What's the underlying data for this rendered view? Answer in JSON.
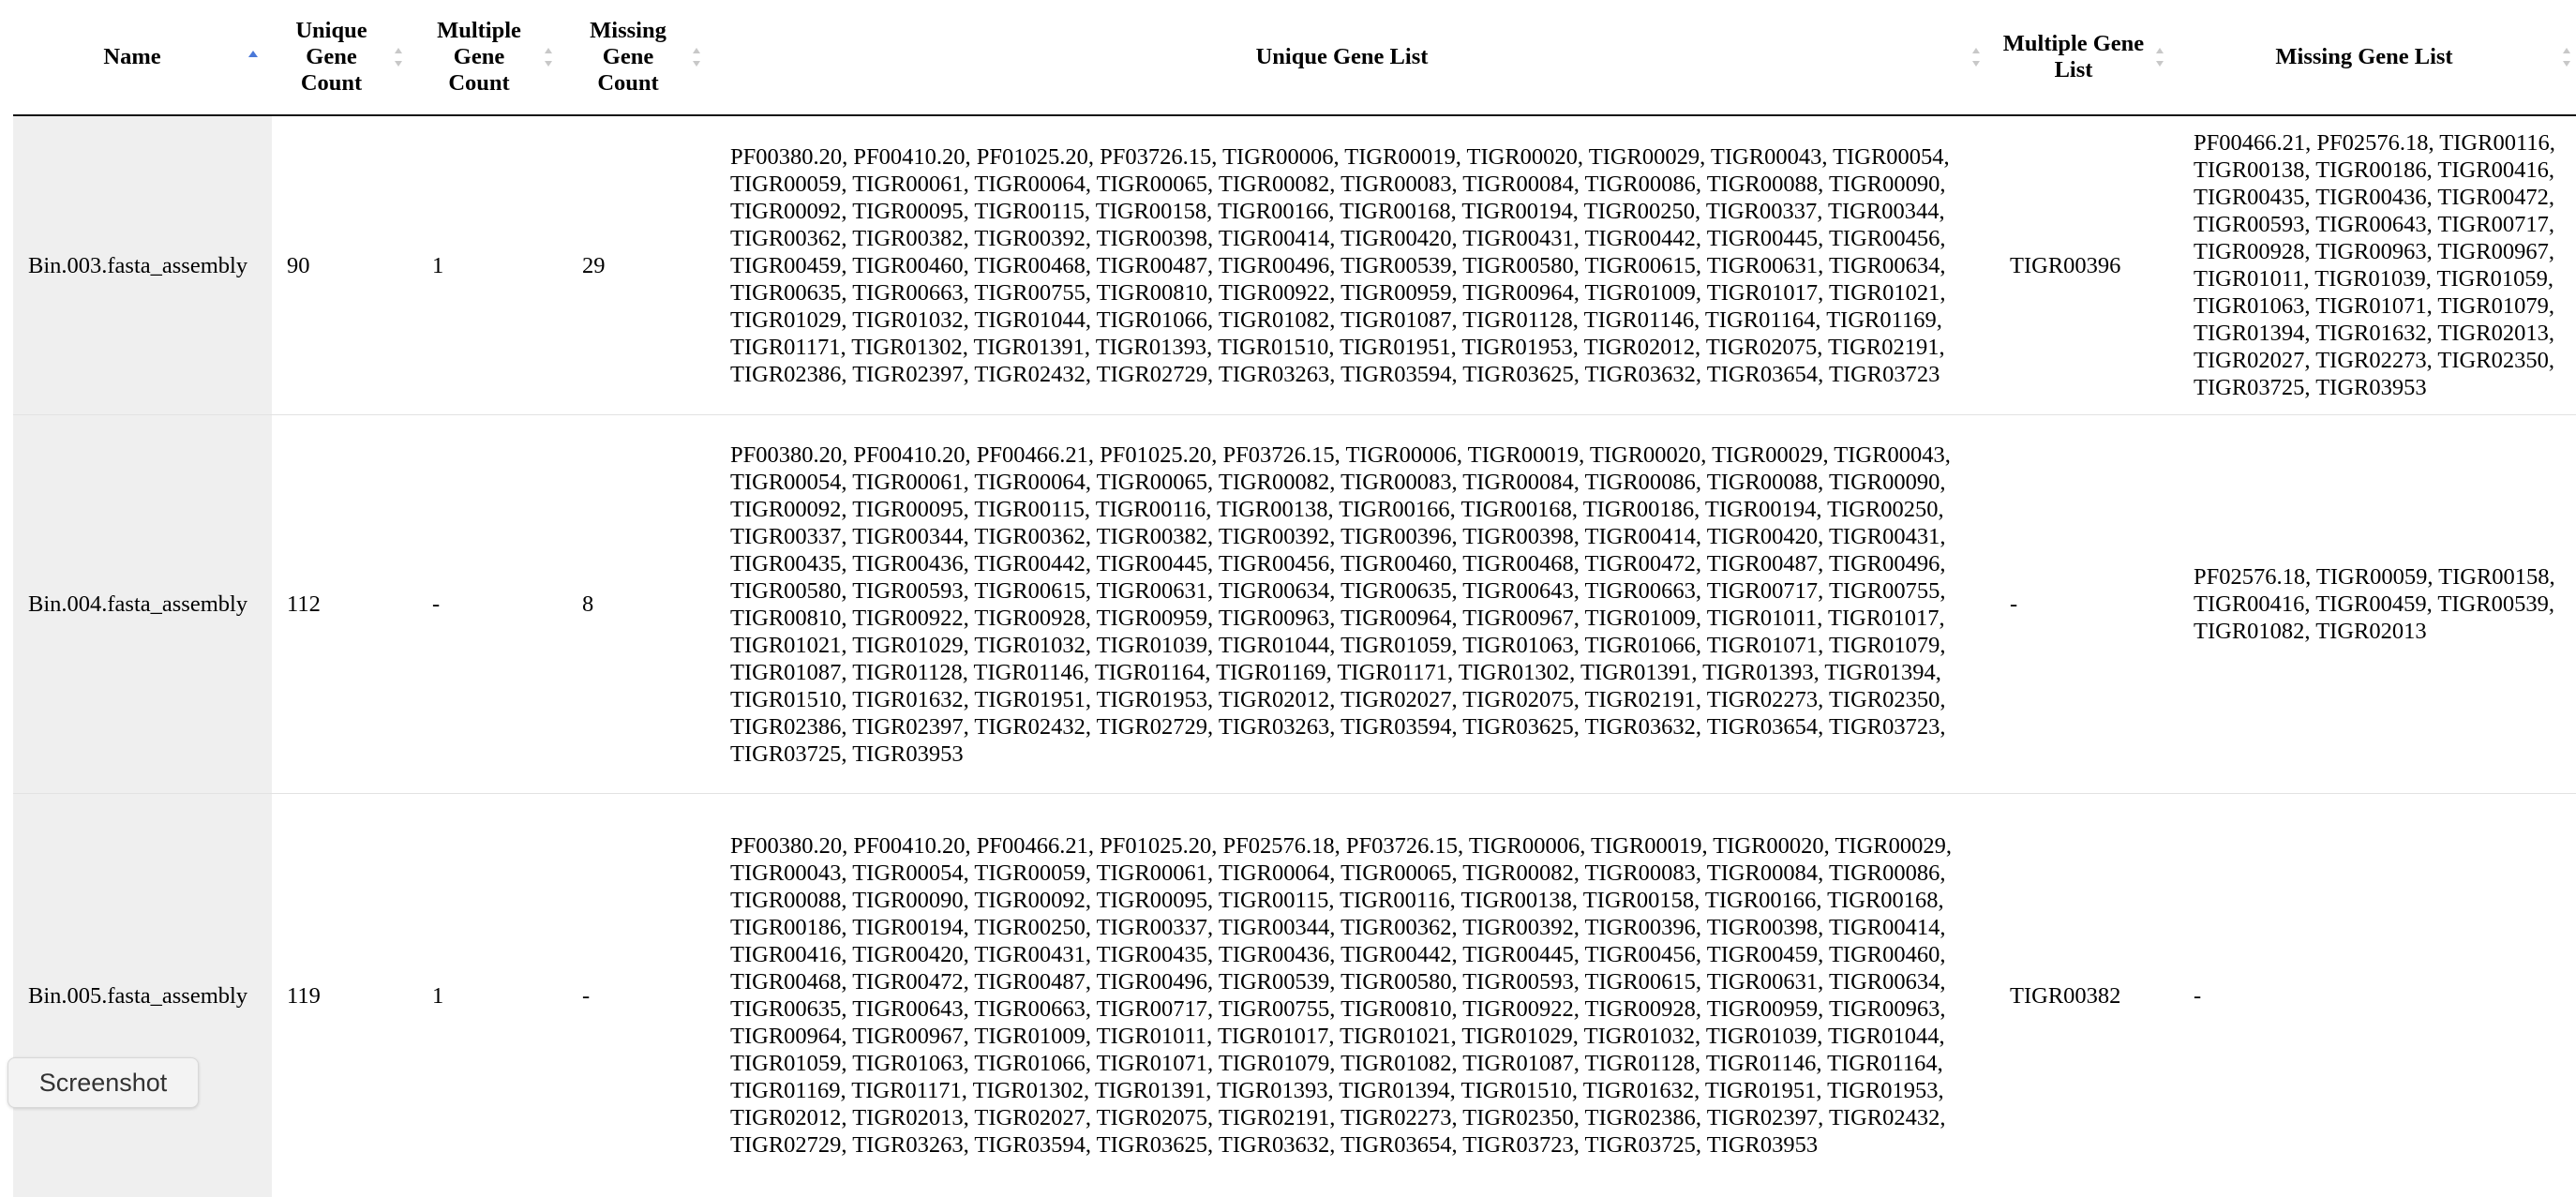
{
  "table": {
    "headers": [
      {
        "label": "Name",
        "sort": "asc"
      },
      {
        "label": "Unique Gene Count",
        "sort": "none"
      },
      {
        "label": "Multiple Gene Count",
        "sort": "none"
      },
      {
        "label": "Missing Gene Count",
        "sort": "none"
      },
      {
        "label": "Unique Gene List",
        "sort": "none"
      },
      {
        "label": "Multiple Gene List",
        "sort": "none"
      },
      {
        "label": "Missing Gene List",
        "sort": "none"
      }
    ],
    "rows": [
      {
        "name": "Bin.003.fasta_assembly",
        "unique_count": "90",
        "multiple_count": "1",
        "missing_count": "29",
        "unique_list": "PF00380.20, PF00410.20, PF01025.20, PF03726.15, TIGR00006, TIGR00019, TIGR00020, TIGR00029, TIGR00043, TIGR00054, TIGR00059, TIGR00061, TIGR00064, TIGR00065, TIGR00082, TIGR00083, TIGR00084, TIGR00086, TIGR00088, TIGR00090, TIGR00092, TIGR00095, TIGR00115, TIGR00158, TIGR00166, TIGR00168, TIGR00194, TIGR00250, TIGR00337, TIGR00344, TIGR00362, TIGR00382, TIGR00392, TIGR00398, TIGR00414, TIGR00420, TIGR00431, TIGR00442, TIGR00445, TIGR00456, TIGR00459, TIGR00460, TIGR00468, TIGR00487, TIGR00496, TIGR00539, TIGR00580, TIGR00615, TIGR00631, TIGR00634, TIGR00635, TIGR00663, TIGR00755, TIGR00810, TIGR00922, TIGR00959, TIGR00964, TIGR01009, TIGR01017, TIGR01021, TIGR01029, TIGR01032, TIGR01044, TIGR01066, TIGR01082, TIGR01087, TIGR01128, TIGR01146, TIGR01164, TIGR01169, TIGR01171, TIGR01302, TIGR01391, TIGR01393, TIGR01510, TIGR01951, TIGR01953, TIGR02012, TIGR02075, TIGR02191, TIGR02386, TIGR02397, TIGR02432, TIGR02729, TIGR03263, TIGR03594, TIGR03625, TIGR03632, TIGR03654, TIGR03723",
        "multiple_list": "TIGR00396",
        "missing_list": "PF00466.21, PF02576.18, TIGR00116, TIGR00138, TIGR00186, TIGR00416, TIGR00435, TIGR00436, TIGR00472, TIGR00593, TIGR00643, TIGR00717, TIGR00928, TIGR00963, TIGR00967, TIGR01011, TIGR01039, TIGR01059, TIGR01063, TIGR01071, TIGR01079, TIGR01394, TIGR01632, TIGR02013, TIGR02027, TIGR02273, TIGR02350, TIGR03725, TIGR03953"
      },
      {
        "name": "Bin.004.fasta_assembly",
        "unique_count": "112",
        "multiple_count": "-",
        "missing_count": "8",
        "unique_list": "PF00380.20, PF00410.20, PF00466.21, PF01025.20, PF03726.15, TIGR00006, TIGR00019, TIGR00020, TIGR00029, TIGR00043, TIGR00054, TIGR00061, TIGR00064, TIGR00065, TIGR00082, TIGR00083, TIGR00084, TIGR00086, TIGR00088, TIGR00090, TIGR00092, TIGR00095, TIGR00115, TIGR00116, TIGR00138, TIGR00166, TIGR00168, TIGR00186, TIGR00194, TIGR00250, TIGR00337, TIGR00344, TIGR00362, TIGR00382, TIGR00392, TIGR00396, TIGR00398, TIGR00414, TIGR00420, TIGR00431, TIGR00435, TIGR00436, TIGR00442, TIGR00445, TIGR00456, TIGR00460, TIGR00468, TIGR00472, TIGR00487, TIGR00496, TIGR00580, TIGR00593, TIGR00615, TIGR00631, TIGR00634, TIGR00635, TIGR00643, TIGR00663, TIGR00717, TIGR00755, TIGR00810, TIGR00922, TIGR00928, TIGR00959, TIGR00963, TIGR00964, TIGR00967, TIGR01009, TIGR01011, TIGR01017, TIGR01021, TIGR01029, TIGR01032, TIGR01039, TIGR01044, TIGR01059, TIGR01063, TIGR01066, TIGR01071, TIGR01079, TIGR01087, TIGR01128, TIGR01146, TIGR01164, TIGR01169, TIGR01171, TIGR01302, TIGR01391, TIGR01393, TIGR01394, TIGR01510, TIGR01632, TIGR01951, TIGR01953, TIGR02012, TIGR02027, TIGR02075, TIGR02191, TIGR02273, TIGR02350, TIGR02386, TIGR02397, TIGR02432, TIGR02729, TIGR03263, TIGR03594, TIGR03625, TIGR03632, TIGR03654, TIGR03723, TIGR03725, TIGR03953",
        "multiple_list": "-",
        "missing_list": "PF02576.18, TIGR00059, TIGR00158, TIGR00416, TIGR00459, TIGR00539, TIGR01082, TIGR02013"
      },
      {
        "name": "Bin.005.fasta_assembly",
        "unique_count": "119",
        "multiple_count": "1",
        "missing_count": "-",
        "unique_list": "PF00380.20, PF00410.20, PF00466.21, PF01025.20, PF02576.18, PF03726.15, TIGR00006, TIGR00019, TIGR00020, TIGR00029, TIGR00043, TIGR00054, TIGR00059, TIGR00061, TIGR00064, TIGR00065, TIGR00082, TIGR00083, TIGR00084, TIGR00086, TIGR00088, TIGR00090, TIGR00092, TIGR00095, TIGR00115, TIGR00116, TIGR00138, TIGR00158, TIGR00166, TIGR00168, TIGR00186, TIGR00194, TIGR00250, TIGR00337, TIGR00344, TIGR00362, TIGR00392, TIGR00396, TIGR00398, TIGR00414, TIGR00416, TIGR00420, TIGR00431, TIGR00435, TIGR00436, TIGR00442, TIGR00445, TIGR00456, TIGR00459, TIGR00460, TIGR00468, TIGR00472, TIGR00487, TIGR00496, TIGR00539, TIGR00580, TIGR00593, TIGR00615, TIGR00631, TIGR00634, TIGR00635, TIGR00643, TIGR00663, TIGR00717, TIGR00755, TIGR00810, TIGR00922, TIGR00928, TIGR00959, TIGR00963, TIGR00964, TIGR00967, TIGR01009, TIGR01011, TIGR01017, TIGR01021, TIGR01029, TIGR01032, TIGR01039, TIGR01044, TIGR01059, TIGR01063, TIGR01066, TIGR01071, TIGR01079, TIGR01082, TIGR01087, TIGR01128, TIGR01146, TIGR01164, TIGR01169, TIGR01171, TIGR01302, TIGR01391, TIGR01393, TIGR01394, TIGR01510, TIGR01632, TIGR01951, TIGR01953, TIGR02012, TIGR02013, TIGR02027, TIGR02075, TIGR02191, TIGR02273, TIGR02350, TIGR02386, TIGR02397, TIGR02432, TIGR02729, TIGR03263, TIGR03594, TIGR03625, TIGR03632, TIGR03654, TIGR03723, TIGR03725, TIGR03953",
        "multiple_list": "TIGR00382",
        "missing_list": "-"
      }
    ]
  },
  "screenshot_button": {
    "label": "Screenshot"
  }
}
